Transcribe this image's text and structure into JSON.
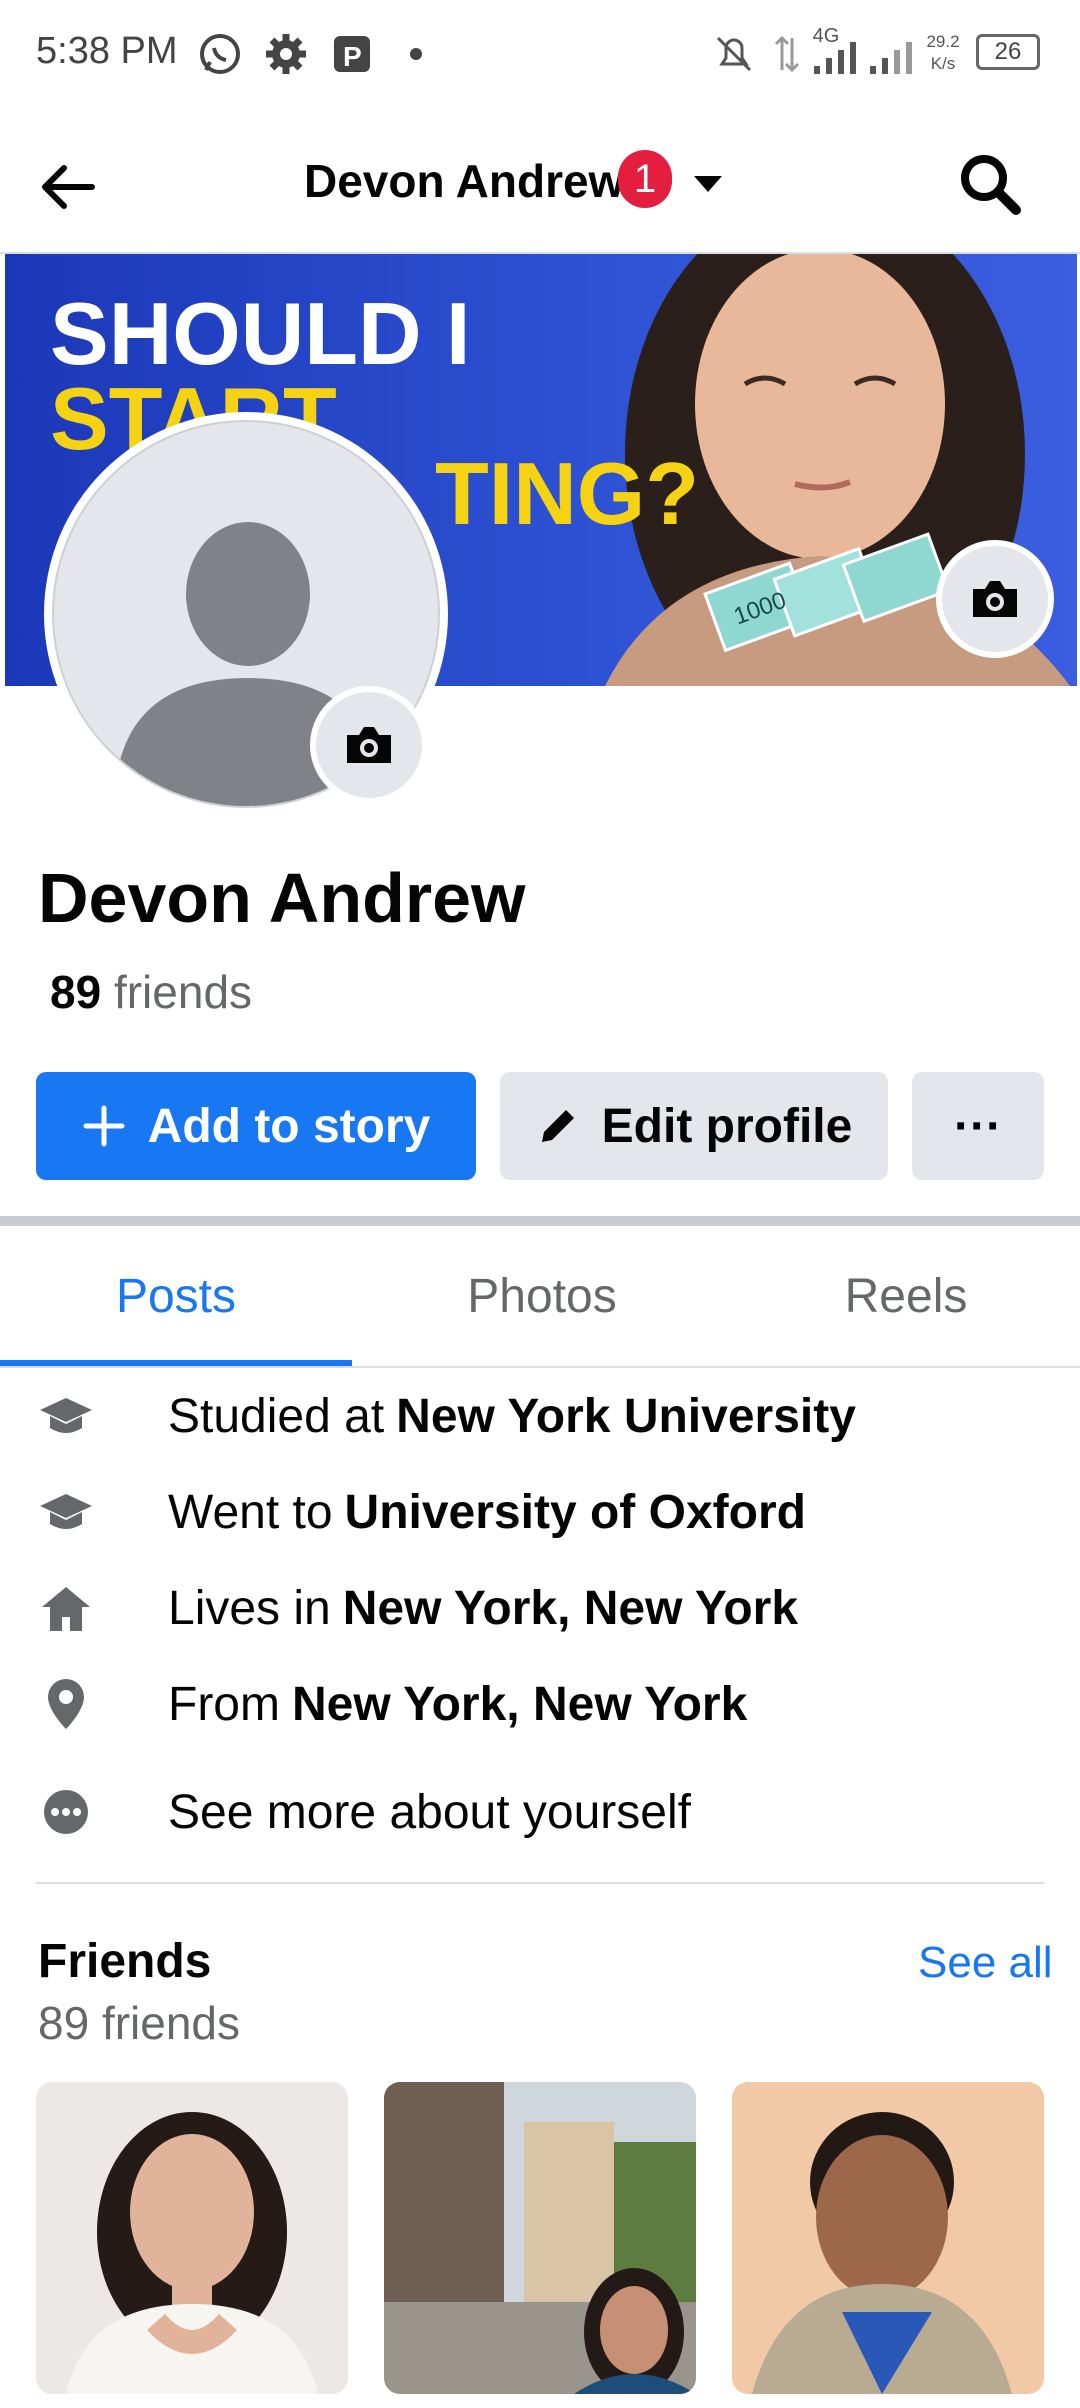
{
  "status_bar": {
    "time": "5:38 PM",
    "network_label": "4G",
    "speed_value": "29.2",
    "speed_unit": "K/s",
    "battery": "26",
    "icons": [
      "whatsapp-icon",
      "gear-icon",
      "parking-icon",
      "dot-icon",
      "muted-bell-icon",
      "data-arrows-icon",
      "signal-icon",
      "signal-icon",
      "battery-icon"
    ]
  },
  "top_nav": {
    "title": "Devon Andrew",
    "badge_count": "1",
    "icons": [
      "back-arrow-icon",
      "caret-down-icon",
      "search-icon"
    ]
  },
  "cover": {
    "text_line1": "SHOULD I",
    "text_line2": "START",
    "text_line3": "TING?",
    "banknote_label": "1000"
  },
  "profile": {
    "name": "Devon Andrew",
    "friends_number": "89",
    "friends_label": "friends"
  },
  "actions": {
    "add_story": "Add to story",
    "edit_profile": "Edit profile",
    "more": "···"
  },
  "tabs": [
    {
      "label": "Posts",
      "active": true
    },
    {
      "label": "Photos",
      "active": false
    },
    {
      "label": "Reels",
      "active": false
    }
  ],
  "intro": [
    {
      "icon": "graduation-cap-icon",
      "prefix": "Studied at",
      "value": "New York University"
    },
    {
      "icon": "graduation-cap-icon",
      "prefix": "Went to",
      "value": "University of Oxford"
    },
    {
      "icon": "home-icon",
      "prefix": "Lives in",
      "value": "New York, New York"
    },
    {
      "icon": "location-pin-icon",
      "prefix": "From",
      "value": "New York, New York"
    },
    {
      "icon": "more-dots-icon",
      "prefix": "See more about yourself",
      "value": ""
    }
  ],
  "friends_section": {
    "title": "Friends",
    "see_all": "See all",
    "count_text": "89 friends"
  },
  "colors": {
    "accent": "#1877f2",
    "badge": "#e41e3f",
    "secondary_button": "#e4e6eb",
    "muted_text": "#65676b"
  }
}
